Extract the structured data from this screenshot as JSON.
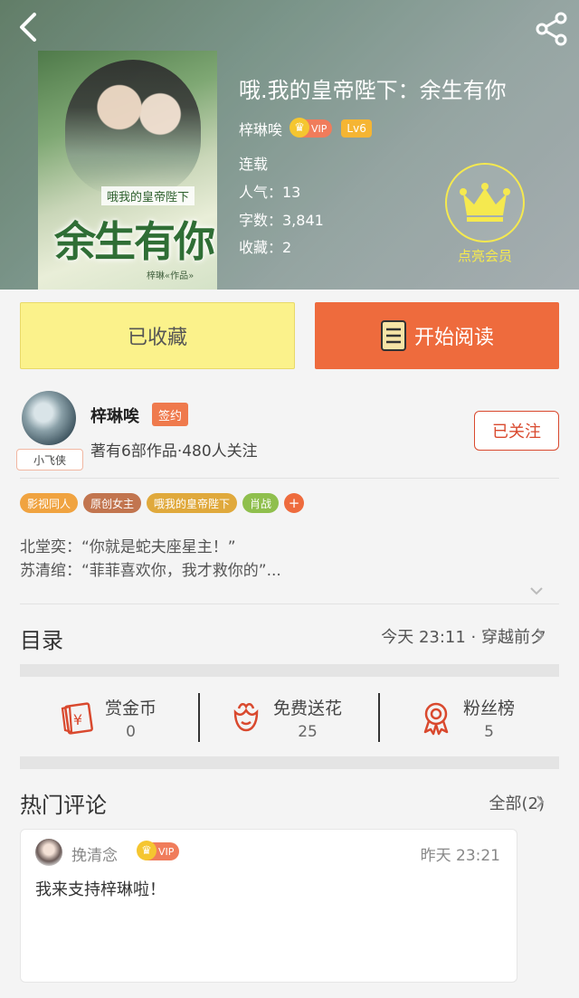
{
  "book": {
    "title": "哦.我的皇帝陛下：余生有你",
    "author": "梓琳唉",
    "vip_label": "VIP",
    "level": "Lv6",
    "status": "连载",
    "popularity": "人气：13",
    "word_count": "字数：3,841",
    "favorites": "收藏：2",
    "member_label": "点亮会员"
  },
  "cover": {
    "small_title": "哦我的皇帝陛下",
    "big_title": "余生有你",
    "author_line": "梓琳«作品»"
  },
  "actions": {
    "collected_label": "已收藏",
    "read_label": "开始阅读"
  },
  "author_card": {
    "name": "梓琳唉",
    "sign_badge": "签约",
    "avatar_tag": "小飞侠",
    "desc": "著有6部作品·480人关注",
    "follow_label": "已关注"
  },
  "tags": [
    {
      "label": "影视同人",
      "color": "#f0a340"
    },
    {
      "label": "原创女主",
      "color": "#c2754f"
    },
    {
      "label": "哦我的皇帝陛下",
      "color": "#e0a93c"
    },
    {
      "label": "肖战",
      "color": "#8fbf4d"
    }
  ],
  "tag_more": "+",
  "intro": {
    "line1": "北堂奕：“你就是蛇夫座星主！”",
    "line2": "苏清绾：“菲菲喜欢你，我才救你的”..."
  },
  "catalog": {
    "title": "目录",
    "latest": "今天 23:11 · 穿越前夕"
  },
  "stats": [
    {
      "label": "赏金币",
      "value": "0",
      "icon": "red-envelope-icon"
    },
    {
      "label": "免费送花",
      "value": "25",
      "icon": "flower-icon"
    },
    {
      "label": "粉丝榜",
      "value": "5",
      "icon": "medal-icon"
    }
  ],
  "comments": {
    "title": "热门评论",
    "all_label": "全部(2)",
    "items": [
      {
        "user": "挽清念",
        "vip": "VIP",
        "time": "昨天 23:21",
        "text": "我来支持梓琳啦！"
      }
    ]
  },
  "colors": {
    "accent": "#ee6b3d",
    "collected_bg": "#fbf28b",
    "member_gold": "#f5e94f",
    "follow_red": "#d9492e"
  }
}
